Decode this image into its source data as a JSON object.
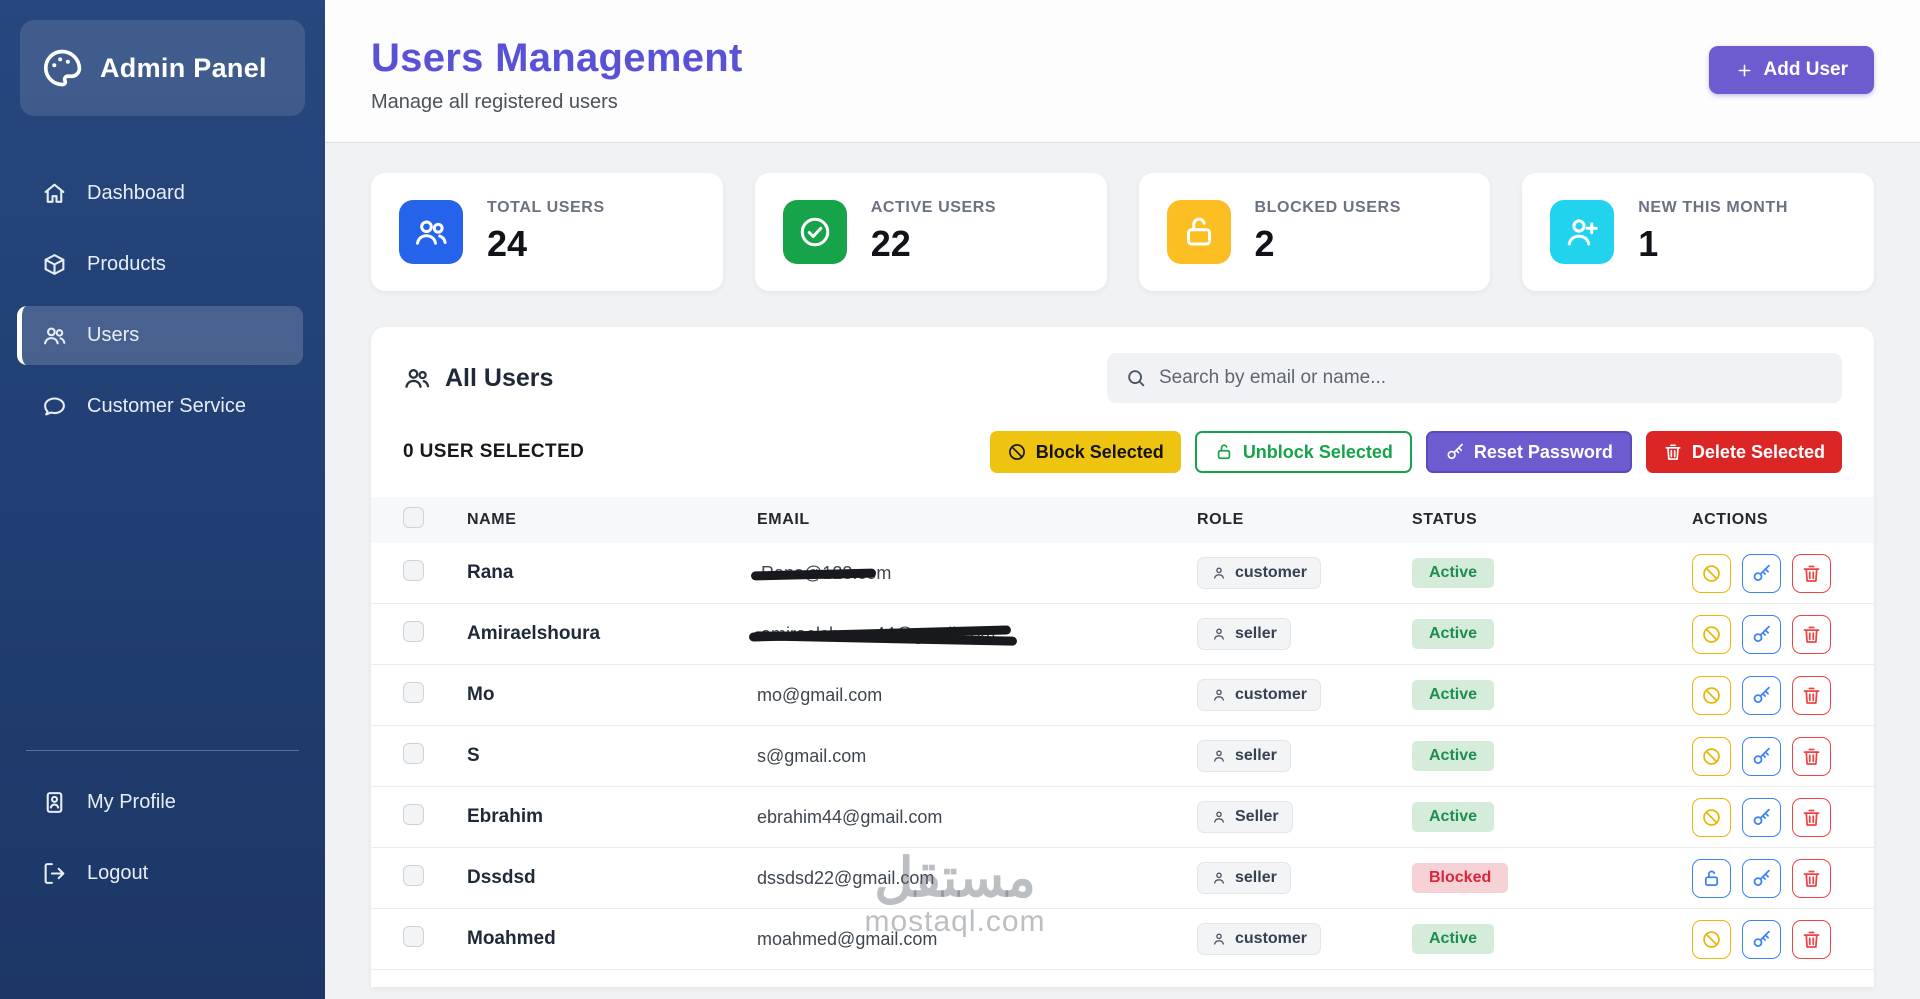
{
  "sidebar": {
    "brand": "Admin Panel",
    "items": [
      {
        "label": "Dashboard",
        "icon": "home-icon",
        "active": false
      },
      {
        "label": "Products",
        "icon": "box-icon",
        "active": false
      },
      {
        "label": "Users",
        "icon": "users-icon",
        "active": true
      },
      {
        "label": "Customer Service",
        "icon": "chat-icon",
        "active": false
      }
    ],
    "footer_items": [
      {
        "label": "My Profile",
        "icon": "profile-icon",
        "active": false
      },
      {
        "label": "Logout",
        "icon": "logout-icon",
        "active": false
      }
    ]
  },
  "header": {
    "title": "Users Management",
    "subtitle": "Manage all registered users",
    "add_user_label": "Add User",
    "title_color": "#5a52d6",
    "add_user_color": "#6d5bd0"
  },
  "stats": [
    {
      "label": "TOTAL USERS",
      "value": "24",
      "icon": "users-group-icon",
      "color": "#2563eb"
    },
    {
      "label": "ACTIVE USERS",
      "value": "22",
      "icon": "check-circle-icon",
      "color": "#16a34a"
    },
    {
      "label": "BLOCKED USERS",
      "value": "2",
      "icon": "lock-icon",
      "color": "#fbbf24"
    },
    {
      "label": "NEW THIS MONTH",
      "value": "1",
      "icon": "user-plus-icon",
      "color": "#22d3ee"
    }
  ],
  "users_panel": {
    "title": "All Users",
    "search_placeholder": "Search by email or name...",
    "selected_text": "0 USER SELECTED",
    "bulk_actions": [
      {
        "label": "Block Selected",
        "icon": "block-icon",
        "style": "block"
      },
      {
        "label": "Unblock Selected",
        "icon": "unlock-icon",
        "style": "unblock"
      },
      {
        "label": "Reset Password",
        "icon": "key-icon",
        "style": "reset"
      },
      {
        "label": "Delete Selected",
        "icon": "trash-icon",
        "style": "delete"
      }
    ],
    "table": {
      "columns": [
        "NAME",
        "EMAIL",
        "ROLE",
        "STATUS",
        "ACTIONS"
      ],
      "rows": [
        {
          "name": "Rana",
          "email": "Rana@123.com",
          "redaction": "line",
          "role": "customer",
          "status": "Active",
          "actions": [
            "block-icon",
            "key-icon",
            "trash-icon"
          ]
        },
        {
          "name": "Amiraelshoura",
          "email": "amiraelshoura44@gmail.com",
          "redaction": "scribble",
          "role": "seller",
          "status": "Active",
          "actions": [
            "block-icon",
            "key-icon",
            "trash-icon"
          ]
        },
        {
          "name": "Mo",
          "email": "mo@gmail.com",
          "redaction": null,
          "role": "customer",
          "status": "Active",
          "actions": [
            "block-icon",
            "key-icon",
            "trash-icon"
          ]
        },
        {
          "name": "S",
          "email": "s@gmail.com",
          "redaction": null,
          "role": "seller",
          "status": "Active",
          "actions": [
            "block-icon",
            "key-icon",
            "trash-icon"
          ]
        },
        {
          "name": "Ebrahim",
          "email": "ebrahim44@gmail.com",
          "redaction": null,
          "role": "Seller",
          "status": "Active",
          "actions": [
            "block-icon",
            "key-icon",
            "trash-icon"
          ]
        },
        {
          "name": "Dssdsd",
          "email": "dssdsd22@gmail.com",
          "redaction": null,
          "role": "seller",
          "status": "Blocked",
          "actions": [
            "unlock-icon",
            "key-icon",
            "trash-icon"
          ]
        },
        {
          "name": "Moahmed",
          "email": "moahmed@gmail.com",
          "redaction": null,
          "role": "customer",
          "status": "Active",
          "actions": [
            "block-icon",
            "key-icon",
            "trash-icon"
          ]
        }
      ]
    }
  },
  "watermark": {
    "arabic": "مستقل",
    "text": "mostaql.com"
  }
}
